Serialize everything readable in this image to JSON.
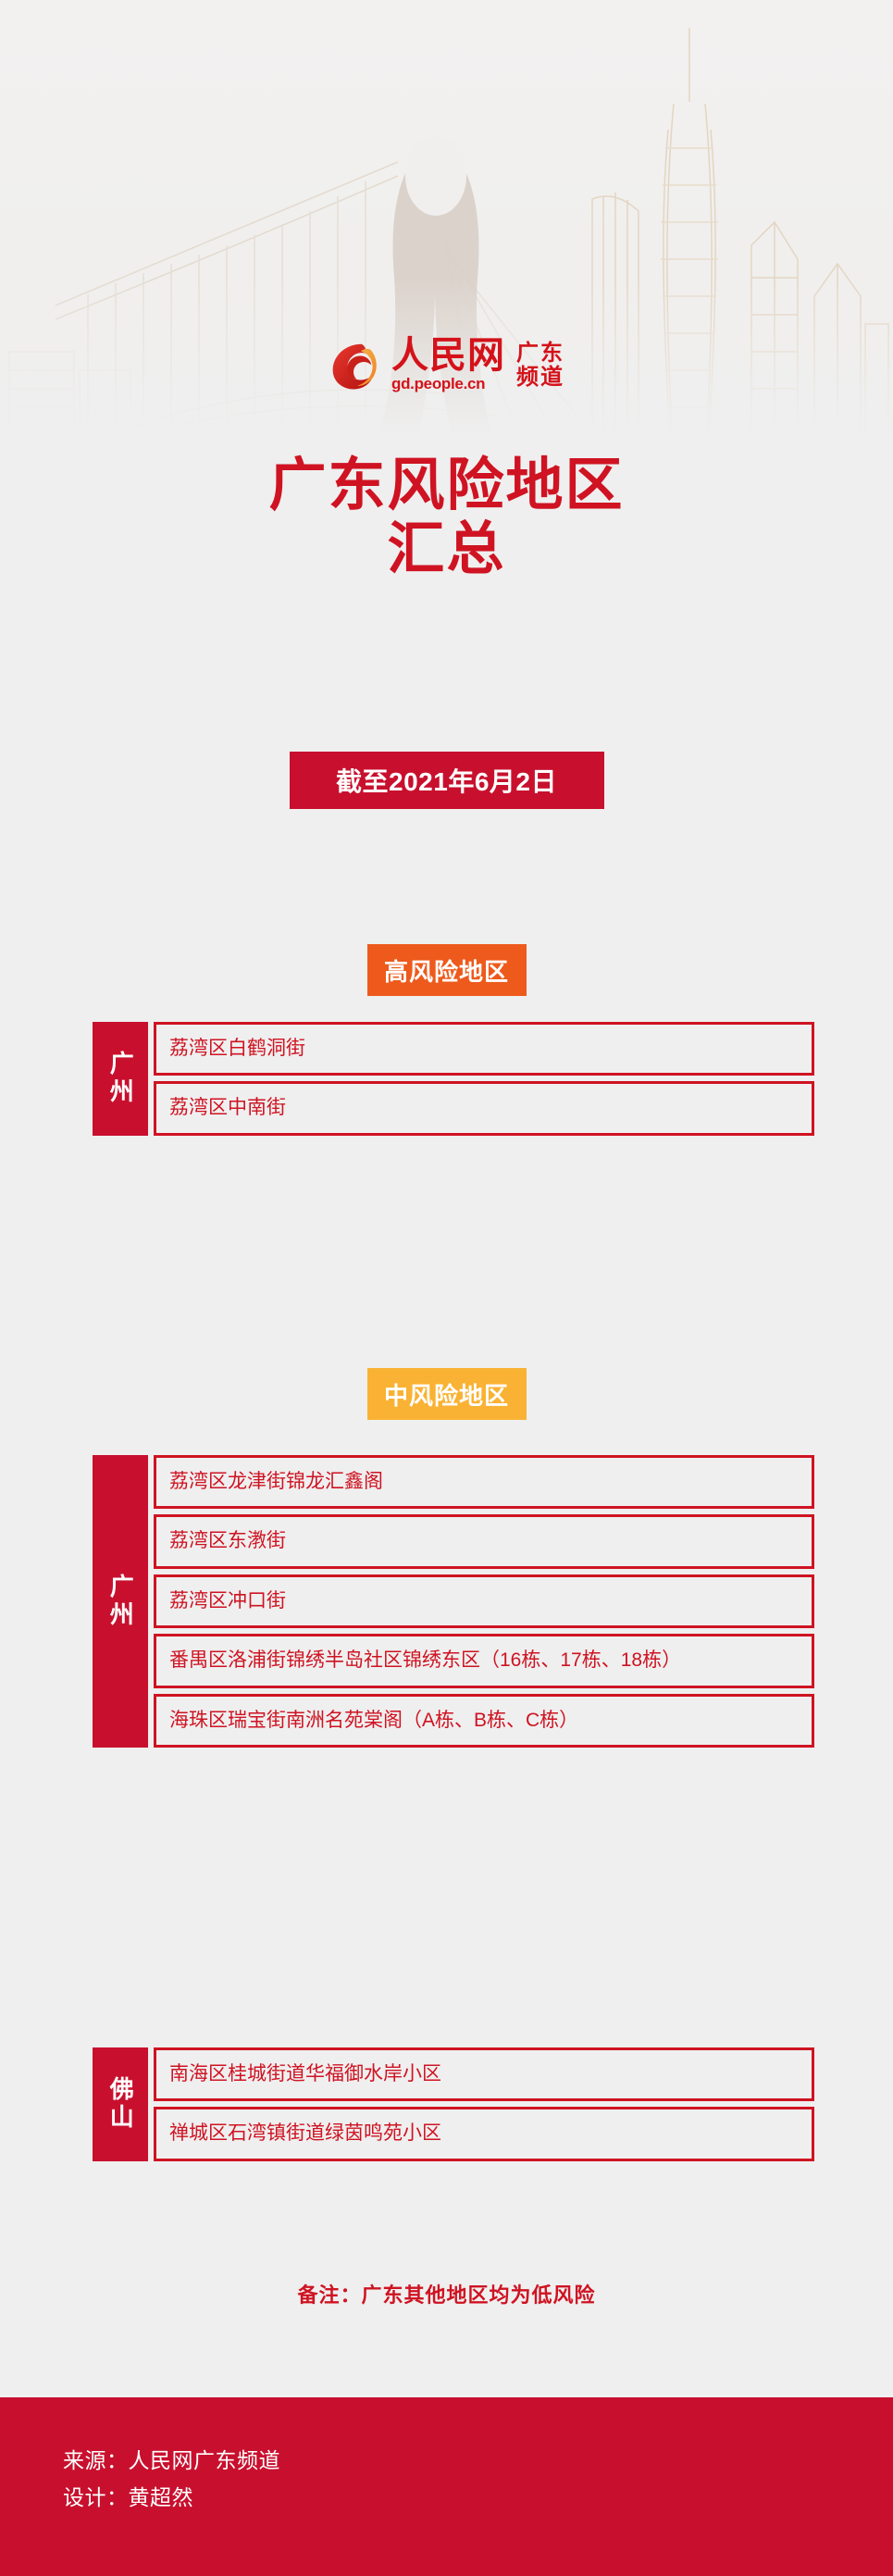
{
  "brand": {
    "logo_icon": "people-cn-swirl-logo",
    "name_cn": "人民网",
    "domain": "gd.people.cn",
    "channel_line1": "广东",
    "channel_line2": "频道"
  },
  "title": {
    "line1": "广东风险地区",
    "line2": "汇总"
  },
  "date_banner": {
    "label": "截至2021年6月2日"
  },
  "sections": [
    {
      "id": "high",
      "pill_label": "高风险地区",
      "pill_color": "#ed5a1c",
      "groups": [
        {
          "city": "广州",
          "areas": [
            "荔湾区白鹤洞街",
            "荔湾区中南街"
          ]
        }
      ]
    },
    {
      "id": "mid",
      "pill_label": "中风险地区",
      "pill_color": "#f9b233",
      "groups": [
        {
          "city": "广州",
          "areas": [
            "荔湾区龙津街锦龙汇鑫阁",
            "荔湾区东漖街",
            "荔湾区冲口街",
            "番禺区洛浦街锦绣半岛社区锦绣东区（16栋、17栋、18栋）",
            "海珠区瑞宝街南洲名苑棠阁（A栋、B栋、C栋）"
          ]
        },
        {
          "city": "佛山",
          "areas": [
            "南海区桂城街道华福御水岸小区",
            "禅城区石湾镇街道绿茵鸣苑小区"
          ]
        }
      ]
    }
  ],
  "note": "备注：广东其他地区均为低风险",
  "footer": {
    "source": "来源：人民网广东频道",
    "designer": "设计：黄超然"
  },
  "colors": {
    "background": "#efefef",
    "brand_red": "#c8102e",
    "text_red": "#cf1322",
    "high_risk_orange": "#ed5a1c",
    "mid_risk_yellow": "#f9b233",
    "white": "#ffffff"
  }
}
